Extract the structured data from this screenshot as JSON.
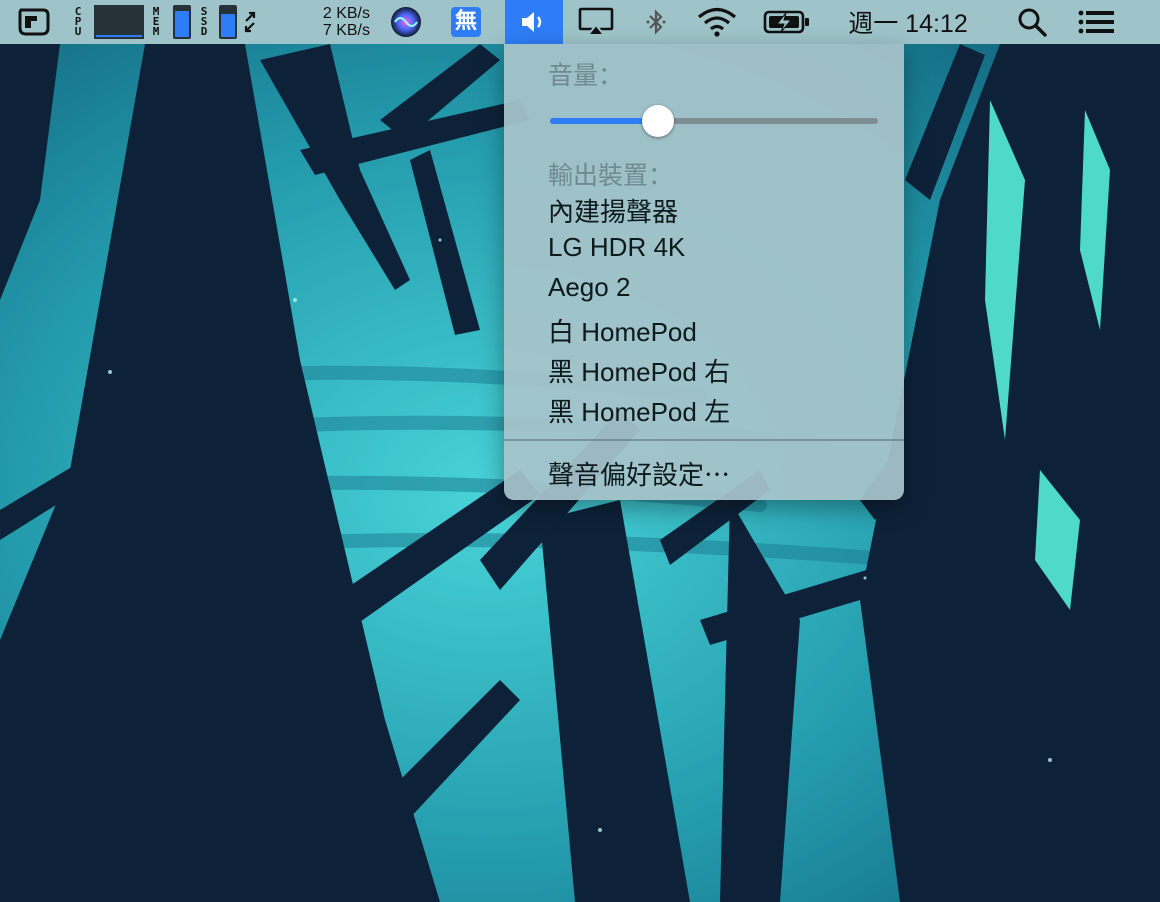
{
  "menubar": {
    "cpu_label": "CPU",
    "mem_label": "MEM",
    "ssd_label": "SSD",
    "mem_level": 0.85,
    "ssd_level": 0.75,
    "net_up": "2 KB/s",
    "net_down": "7 KB/s",
    "input_method_glyph": "無",
    "clock": "週一 14:12",
    "accent_color": "#2f7df6",
    "icons": [
      "app-icon",
      "cpu-graph-icon",
      "mem-gauge-icon",
      "ssd-gauge-icon",
      "expand-arrows-icon",
      "siri-icon",
      "input-method-icon",
      "volume-icon",
      "airplay-icon",
      "bluetooth-icon",
      "wifi-icon",
      "battery-charging-icon",
      "spotlight-search-icon",
      "notification-center-icon"
    ]
  },
  "sound_menu": {
    "volume_label": "音量：",
    "volume_level": 0.33,
    "output_label": "輸出裝置：",
    "devices": [
      "內建揚聲器",
      "LG HDR 4K",
      "Aego 2",
      "白 HomePod",
      "黑 HomePod 右",
      "黑 HomePod 左"
    ],
    "preferences": "聲音偏好設定⋯"
  }
}
